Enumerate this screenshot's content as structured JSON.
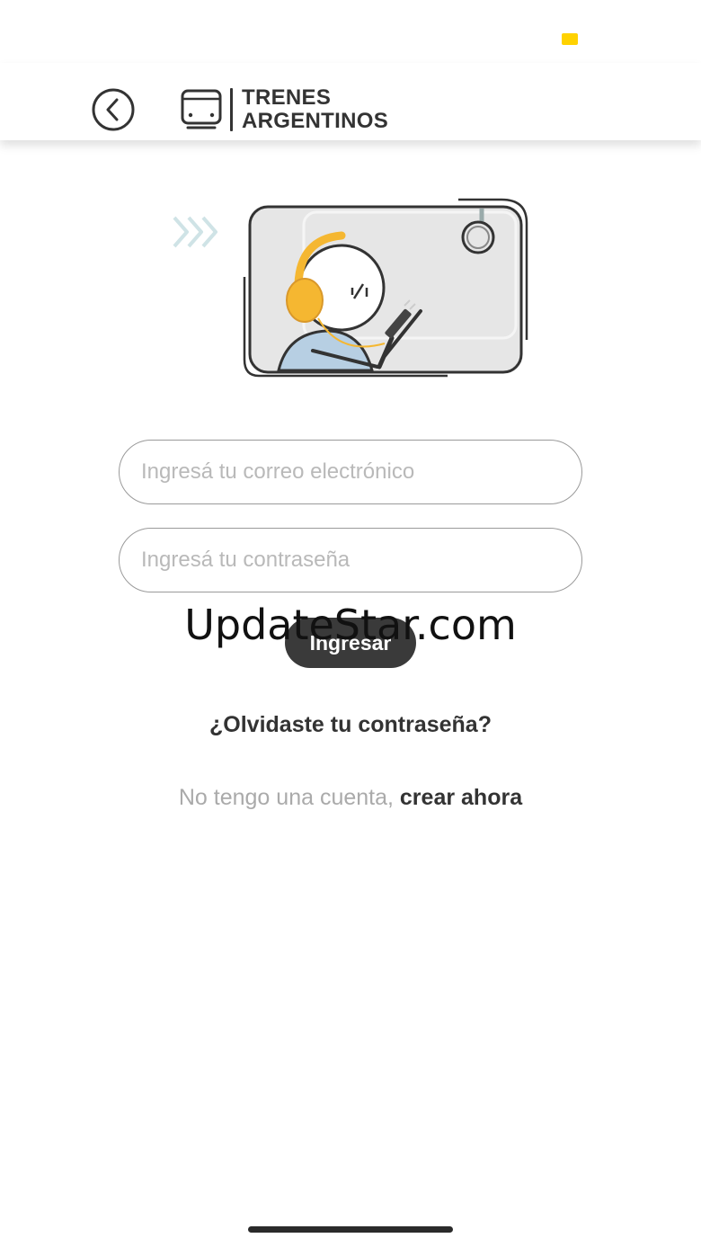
{
  "status_bar": {
    "indicator_color": "#FFD200"
  },
  "header": {
    "back_icon": "chevron-left-circle-icon",
    "brand_icon": "train-front-icon",
    "brand_line1": "TRENES",
    "brand_line2": "ARGENTINOS"
  },
  "illustration": {
    "icon": "person-with-headphones-on-train-illustration",
    "accent_color": "#F5B731"
  },
  "login": {
    "email_placeholder": "Ingresá tu correo electrónico",
    "email_value": "",
    "password_placeholder": "Ingresá tu contraseña",
    "password_value": "",
    "submit_label": "Ingresar",
    "forgot_password": "¿Olvidaste tu contraseña?",
    "no_account_text": "No tengo una cuenta, ",
    "create_account_link": "crear ahora"
  },
  "watermark": {
    "text": "UpdateStar.com"
  }
}
